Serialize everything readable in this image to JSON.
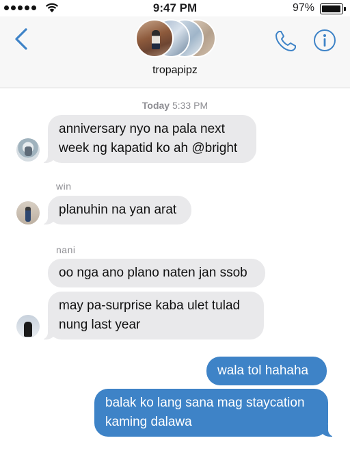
{
  "status_bar": {
    "time": "9:47 PM",
    "battery_percent": "97%",
    "signal_bars": 5,
    "battery_level": 0.97
  },
  "header": {
    "group_name": "tropapipz",
    "icons": [
      "chevron-left-icon",
      "phone-icon",
      "info-icon"
    ]
  },
  "colors": {
    "accent": "#3e83c7",
    "incoming_bubble": "#e9e9eb",
    "outgoing_bubble": "#3e83c7",
    "meta_text": "#8e8e93"
  },
  "conversation": {
    "timestamp_day": "Today",
    "timestamp_time": "5:33 PM",
    "messages": [
      {
        "direction": "in",
        "sender": "",
        "lines": [
          "anniversary nyo na pala next",
          "week ng kapatid ko ah @bright"
        ]
      },
      {
        "direction": "in",
        "sender": "win",
        "lines": [
          "planuhin na yan arat"
        ]
      },
      {
        "direction": "in",
        "sender": "nani",
        "lines": [
          "oo nga ano plano naten jan ssob"
        ]
      },
      {
        "direction": "in",
        "sender": "nani",
        "lines": [
          "may pa-surprise kaba ulet tulad",
          "nung last year"
        ]
      },
      {
        "direction": "out",
        "sender": "",
        "lines": [
          "wala tol hahaha"
        ]
      },
      {
        "direction": "out",
        "sender": "",
        "lines": [
          "balak ko lang sana mag staycation",
          "kaming dalawa"
        ]
      }
    ]
  }
}
